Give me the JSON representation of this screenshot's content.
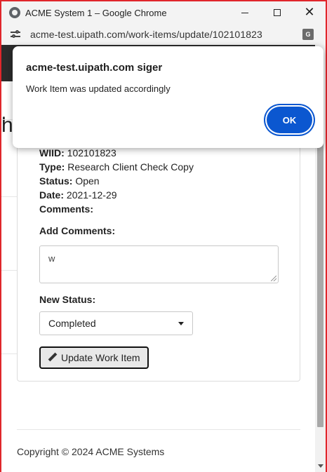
{
  "window": {
    "title": "ACME System 1 – Google Chrome"
  },
  "addressbar": {
    "url": "acme-test.uipath.com/work-items/update/102101823"
  },
  "page": {
    "partial_heading": "h",
    "work_item": {
      "wiid_label": "WIID:",
      "wiid_value": "102101823",
      "type_label": "Type:",
      "type_value": "Research Client Check Copy",
      "status_label": "Status:",
      "status_value": "Open",
      "date_label": "Date:",
      "date_value": "2021-12-29",
      "comments_label": "Comments:"
    },
    "add_comments_label": "Add Comments:",
    "add_comments_value": "w",
    "new_status_label": "New Status:",
    "new_status_selected": "Completed",
    "update_button_label": "Update Work Item",
    "footer": "Copyright © 2024 ACME Systems"
  },
  "dialog": {
    "title": "acme-test.uipath.com siger",
    "message": "Work Item was updated accordingly",
    "ok_label": "OK"
  },
  "colors": {
    "frame_border": "#e0262b",
    "ok_button": "#0b57d0"
  }
}
